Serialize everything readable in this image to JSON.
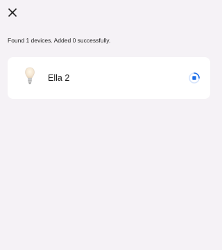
{
  "header": {
    "close_icon": "close-icon"
  },
  "status": {
    "message": "Found 1 devices. Added 0 successfully."
  },
  "devices": [
    {
      "name": "Ella 2",
      "icon": "light-bulb-icon",
      "state_icon": "progress-spinner-icon"
    }
  ],
  "colors": {
    "background": "#f5f2f6",
    "card": "#ffffff",
    "accent": "#1e6fe8"
  }
}
